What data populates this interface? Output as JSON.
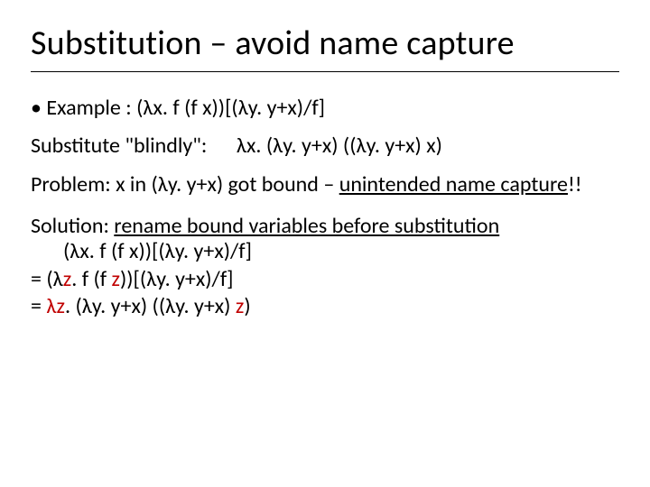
{
  "title": "Substitution – avoid name capture",
  "bullet1": "Example :   (λx. f (f x))[(λy. y+x)/f]",
  "line_subst_label": "Substitute \"blindly\":",
  "line_subst_expr": "λx. (λy. y+x) ((λy. y+x) x)",
  "problem_prefix": "Problem: x in (λy. y+x) got bound – ",
  "problem_underlined": "unintended name capture",
  "problem_suffix": "!!",
  "solution_prefix": "Solution: ",
  "solution_underlined": "rename bound variables before substitution",
  "sub_line1": "   (λx. f (f x))[(λy. y+x)/f]",
  "sub_line2_prefix": "= (λ",
  "sub_line2_z1": "z",
  "sub_line2_mid": ". f (f ",
  "sub_line2_z2": "z",
  "sub_line2_suffix": "))[(λy. y+x)/f]",
  "sub_line3_prefix": "= ",
  "sub_line3_lz": "λz",
  "sub_line3_mid": ". (λy. y+x) ((λy. y+x) ",
  "sub_line3_z": "z",
  "sub_line3_suffix": ")"
}
